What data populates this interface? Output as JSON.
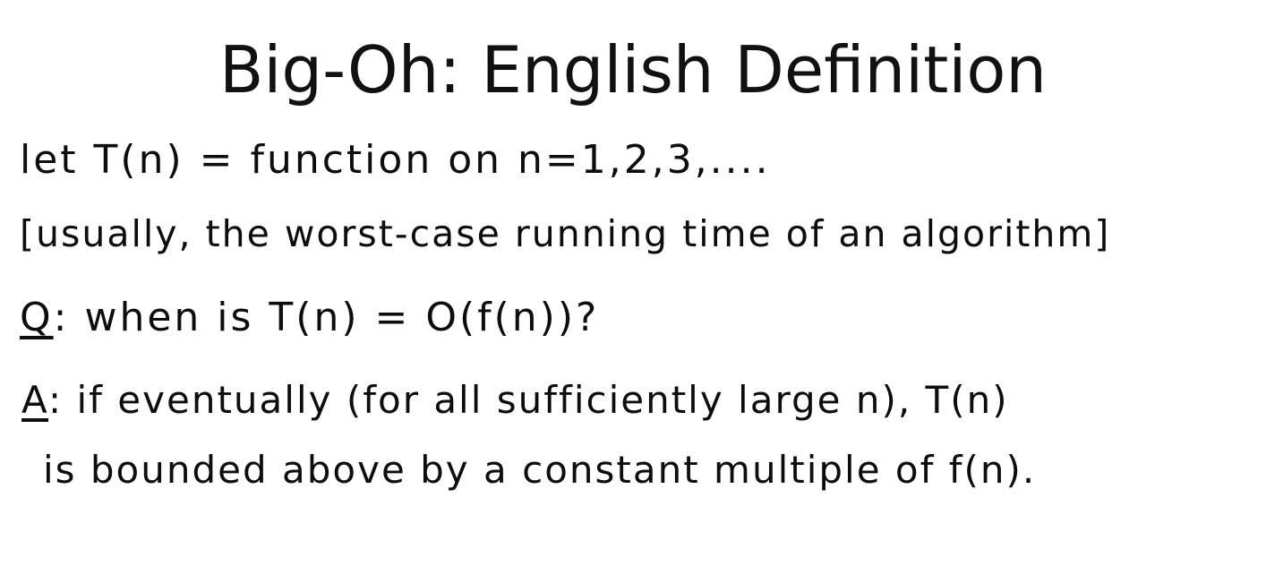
{
  "slide": {
    "title": "Big-Oh: English Definition",
    "line1": "let T(n) = function on n=1,2,3,....",
    "line2": "[usually, the worst-case running time of an algorithm]",
    "question_label": "Q",
    "question_text": ": when is T(n) = O(f(n))?",
    "answer_label": "A",
    "answer_text": ": if eventually (for all sufficiently large n), T(n)",
    "answer_text_cont": "is bounded above by a constant multiple of f(n)."
  }
}
